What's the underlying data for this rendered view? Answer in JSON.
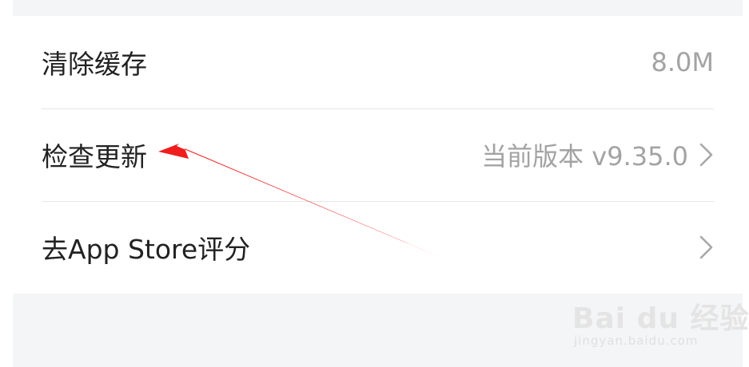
{
  "settings": {
    "clear_cache": {
      "label": "清除缓存",
      "value": "8.0M"
    },
    "check_update": {
      "label": "检查更新",
      "value": "当前版本 v9.35.0"
    },
    "rate_app": {
      "label": "去App Store评分"
    }
  },
  "annotation": {
    "arrow_color": "#f01d1d",
    "target": "check_update"
  },
  "watermark": {
    "brand": "Bai du 经验",
    "url": "jingyan.baidu.com"
  },
  "colors": {
    "label": "#222222",
    "secondary": "#a3a3a3",
    "divider": "#e6e6e6",
    "band": "#f4f5f6"
  }
}
